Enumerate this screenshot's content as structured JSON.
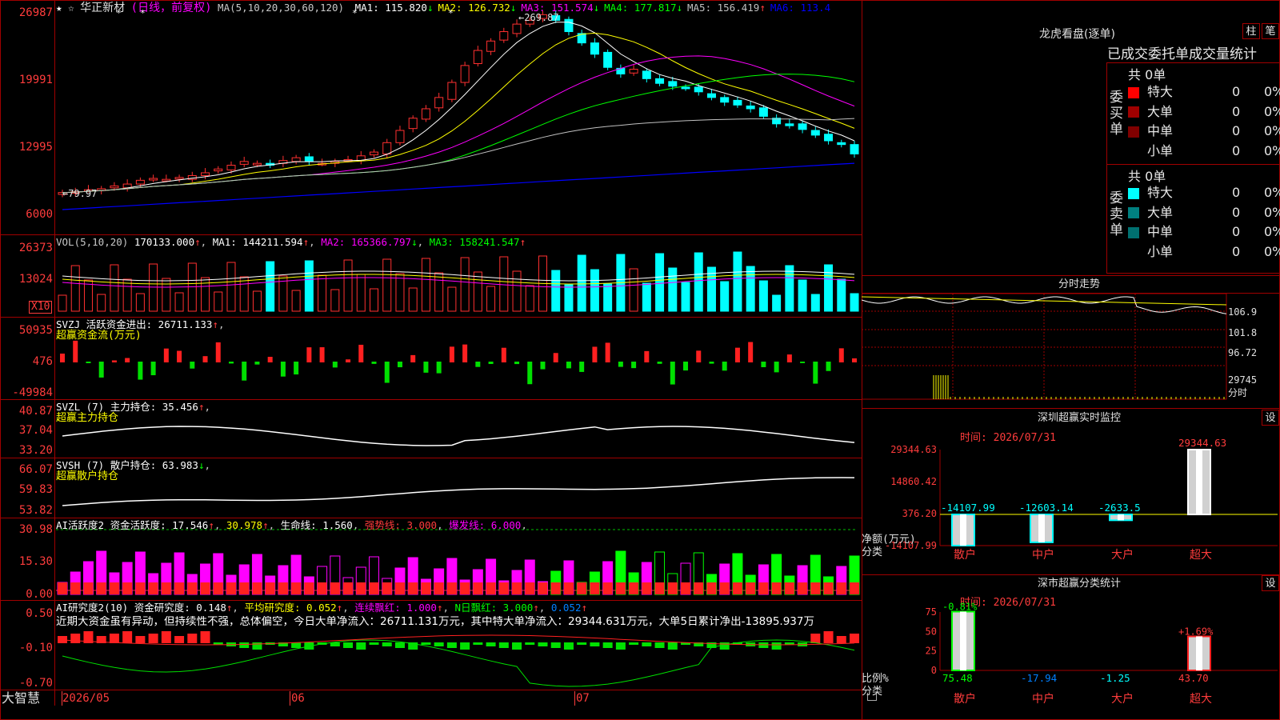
{
  "header": {
    "stock_name": "华正新材",
    "chart_mode": "(日线，前复权)",
    "ma_label": "MA(5,10,20,30,60,120)",
    "ma_values": [
      {
        "label": "MA1:",
        "value": "115.820",
        "arrow": "↓",
        "color": "#ffffff"
      },
      {
        "label": "MA2:",
        "value": "126.732",
        "arrow": "↓",
        "color": "#ffff00"
      },
      {
        "label": "MA3:",
        "value": "151.574",
        "arrow": "↓",
        "color": "#ff00ff"
      },
      {
        "label": "MA4:",
        "value": "177.817",
        "arrow": "↓",
        "color": "#00ff00"
      },
      {
        "label": "MA5:",
        "value": "156.419",
        "arrow": "↑",
        "color": "#c0c0c0"
      },
      {
        "label": "MA6:",
        "value": "113.4",
        "arrow": "",
        "color": "#0000ff"
      }
    ],
    "high_marker": "269.87",
    "low_marker": "79.97"
  },
  "price_axis": [
    "26987",
    "19991",
    "12995",
    "6000"
  ],
  "vol_panel": {
    "title": "VOL(5,10,20)",
    "value": "170133.000",
    "ma1": "MA1: 144211.594",
    "ma2": "MA2: 165366.797",
    "ma3": "MA3: 158241.547",
    "axis": [
      "26373",
      "13024"
    ],
    "unit": "X10"
  },
  "svzj_panel": {
    "title": "SVZJ  活跃资金进出: 26711.133",
    "subtitle": "超赢资金流(万元)",
    "axis": [
      "50935",
      "476",
      "-49984"
    ]
  },
  "svzl_panel": {
    "title": "SVZL (7) 主力持仓: 35.456",
    "subtitle": "超赢主力持仓",
    "axis": [
      "40.87",
      "37.04",
      "33.20"
    ]
  },
  "svsh_panel": {
    "title": "SVSH (7) 散户持仓: 63.983",
    "subtitle": "超赢散户持仓",
    "axis": [
      "66.07",
      "59.83",
      "53.82"
    ]
  },
  "ai1_panel": {
    "title": "AI活跃度2 资金活跃度: 17.546",
    "v2": "30.978",
    "life": "生命线: 1.560",
    "strong": "强势线: 3.000",
    "burst": "爆发线: 6.000",
    "axis": [
      "30.98",
      "15.30",
      "0.00"
    ]
  },
  "ai2_panel": {
    "title": "AI研究度2(10) 资金研究度: 0.148",
    "avg": "平均研究度: 0.052",
    "cont": "连续飘红: 1.000",
    "nday": "N日飘红: 3.000",
    "last": "0.052",
    "comment": "近期大资金虽有异动，但持续性不强，总体偏空，今日大单净流入：26711.131万元，其中特大单净流入：29344.631万元，大单5日累计净出-13895.937万",
    "axis": [
      "0.50",
      "-0.10",
      "-0.70"
    ]
  },
  "date_axis": [
    "2026/05",
    "06",
    "07"
  ],
  "brand": "大智慧",
  "dragon_tiger": {
    "title": "龙虎看盘(逐单)",
    "btn1": "柱",
    "btn2": "笔",
    "subtitle": "已成交委托单成交量统计",
    "buy_label": "委买单",
    "sell_label": "委卖单",
    "buy_total": "共 0单",
    "sell_total": "共 0单",
    "buy_rows": [
      {
        "name": "特大",
        "count": "0",
        "pct": "0%",
        "color": "#ff0000"
      },
      {
        "name": "大单",
        "count": "0",
        "pct": "0%",
        "color": "#a00000"
      },
      {
        "name": "中单",
        "count": "0",
        "pct": "0%",
        "color": "#800000"
      },
      {
        "name": "小单",
        "count": "0",
        "pct": "0%",
        "color": "#000000"
      }
    ],
    "sell_rows": [
      {
        "name": "特大",
        "count": "0",
        "pct": "0%",
        "color": "#00ffff"
      },
      {
        "name": "大单",
        "count": "0",
        "pct": "0%",
        "color": "#008080"
      },
      {
        "name": "中单",
        "count": "0",
        "pct": "0%",
        "color": "#007070"
      },
      {
        "name": "小单",
        "count": "0",
        "pct": "0%",
        "color": "#000000"
      }
    ]
  },
  "intraday": {
    "title": "分时走势",
    "axis": [
      "106.9",
      "101.8",
      "96.72",
      "29745",
      "分时"
    ]
  },
  "sz_monitor": {
    "title": "深圳超赢实时监控",
    "btn": "设",
    "time": "时间: 2026/07/31",
    "axis": [
      "29344.63",
      "14860.42",
      "376.20",
      "-14107.99"
    ],
    "y_label": "净额(万元)",
    "x_label": "分类",
    "bars": [
      {
        "cat": "散户",
        "value": "-14107.99"
      },
      {
        "cat": "中户",
        "value": "-12603.14"
      },
      {
        "cat": "大户",
        "value": "-2633.5"
      },
      {
        "cat": "超大",
        "value": "29344.63"
      }
    ]
  },
  "sz_stats": {
    "title": "深市超赢分类统计",
    "btn": "设",
    "time": "时间: 2026/07/31",
    "axis": [
      "75",
      "50",
      "25",
      "0"
    ],
    "y_label": "比例%",
    "x_label": "分类",
    "bars": [
      {
        "cat": "散户",
        "value": "75.48",
        "top": "-0.81%"
      },
      {
        "cat": "中户",
        "value": "-17.94",
        "top": ""
      },
      {
        "cat": "大户",
        "value": "-1.25",
        "top": ""
      },
      {
        "cat": "超大",
        "value": "43.70",
        "top": "+1.69%"
      }
    ]
  }
}
